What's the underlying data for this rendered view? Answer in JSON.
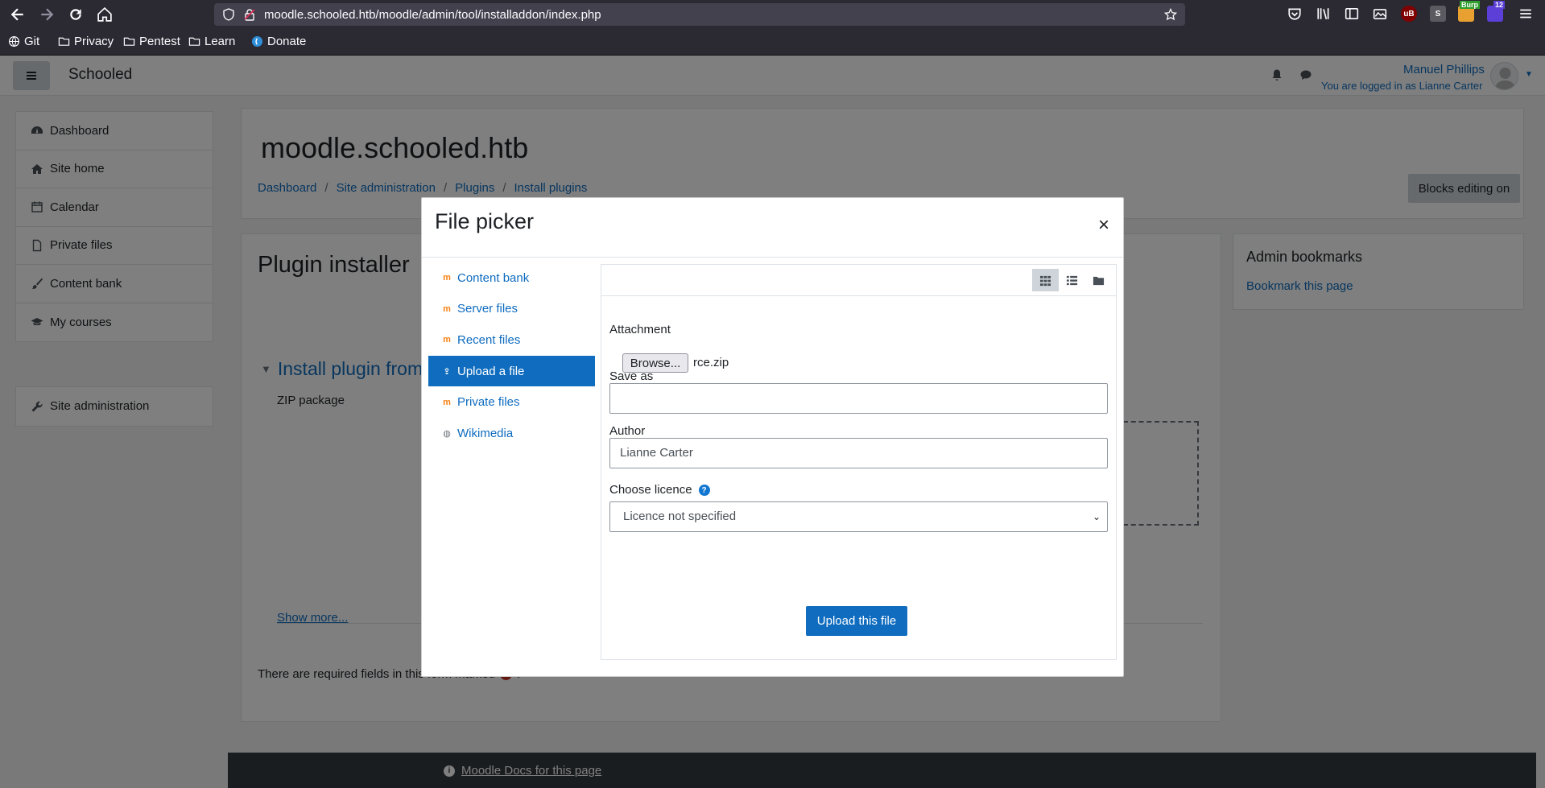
{
  "browser": {
    "url": "moodle.schooled.htb/moodle/admin/tool/installaddon/index.php",
    "bookmarks": [
      "Git",
      "Privacy",
      "Pentest",
      "Learn",
      "Donate"
    ],
    "ext_badge": "12",
    "ext_burp": "Burp"
  },
  "navbar": {
    "brand": "Schooled",
    "user_name": "Manuel Phillips",
    "login_as": "You are logged in as Lianne Carter"
  },
  "drawer": {
    "items": [
      "Dashboard",
      "Site home",
      "Calendar",
      "Private files",
      "Content bank",
      "My courses"
    ],
    "admin": "Site administration"
  },
  "header": {
    "site_title": "moodle.schooled.htb",
    "breadcrumb": [
      "Dashboard",
      "Site administration",
      "Plugins",
      "Install plugins"
    ],
    "breadcrumb_sep": "/",
    "blocks_editing": "Blocks editing on"
  },
  "content": {
    "title": "Plugin installer",
    "install_heading": "Install plugin from",
    "zip_label": "ZIP package",
    "show_more": "Show more...",
    "required_note": "There are required fields in this form marked",
    "required_note_end": "."
  },
  "admin_bookmarks": {
    "title": "Admin bookmarks",
    "link": "Bookmark this page"
  },
  "footer": {
    "docs_link": "Moodle Docs for this page"
  },
  "file_picker": {
    "title": "File picker",
    "close": "×",
    "repositories": [
      {
        "label": "Content bank",
        "icon": "moodle-icon",
        "active": false
      },
      {
        "label": "Server files",
        "icon": "moodle-icon",
        "active": false
      },
      {
        "label": "Recent files",
        "icon": "moodle-icon",
        "active": false
      },
      {
        "label": "Upload a file",
        "icon": "upload-icon",
        "active": true
      },
      {
        "label": "Private files",
        "icon": "moodle-icon",
        "active": false
      },
      {
        "label": "Wikimedia",
        "icon": "wikimedia-icon",
        "active": false
      }
    ],
    "attachment_label": "Attachment",
    "browse_button": "Browse...",
    "selected_file": "rce.zip",
    "save_as_label": "Save as",
    "save_as_value": "",
    "author_label": "Author",
    "author_value": "Lianne Carter",
    "licence_label": "Choose licence",
    "licence_value": "Licence not specified",
    "upload_button": "Upload this file"
  },
  "colors": {
    "accent": "#0f6cbf",
    "browser_chrome": "#2b2a33"
  }
}
